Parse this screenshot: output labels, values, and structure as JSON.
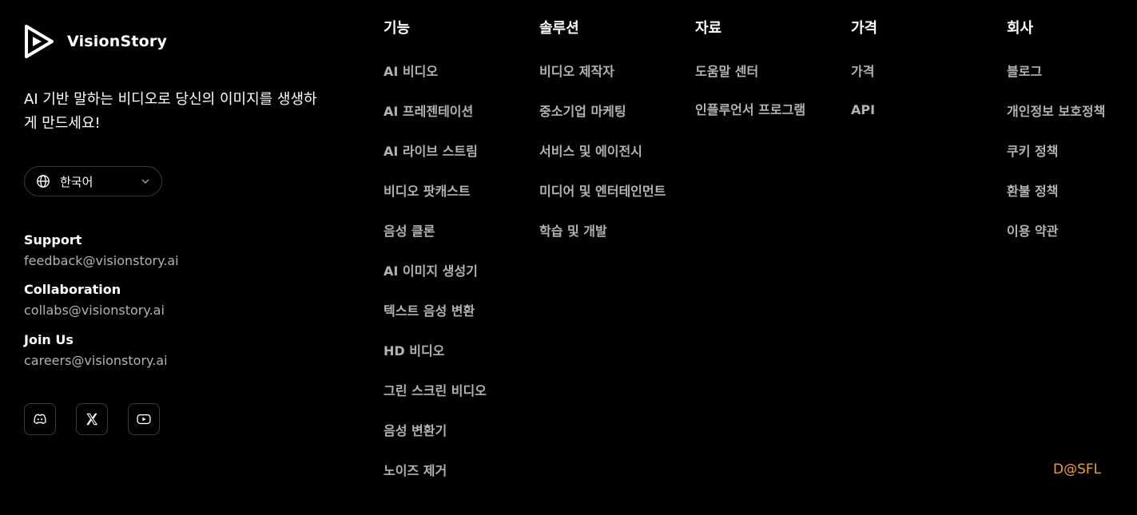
{
  "brand": {
    "name": "VisionStory"
  },
  "tagline": "AI 기반 말하는 비디오로 당신의 이미지를 생생하게 만드세요!",
  "language": {
    "selected": "한국어",
    "icon": "globe-icon"
  },
  "contacts": [
    {
      "title": "Support",
      "email": "feedback@visionstory.ai"
    },
    {
      "title": "Collaboration",
      "email": "collabs@visionstory.ai"
    },
    {
      "title": "Join Us",
      "email": "careers@visionstory.ai"
    }
  ],
  "socials": [
    {
      "name": "discord",
      "icon": "discord-icon"
    },
    {
      "name": "x",
      "icon": "x-icon"
    },
    {
      "name": "youtube",
      "icon": "youtube-icon"
    }
  ],
  "columns": [
    {
      "title": "기능",
      "links": [
        "AI 비디오",
        "AI 프레젠테이션",
        "AI 라이브 스트림",
        "비디오 팟캐스트",
        "음성 클론",
        "AI 이미지 생성기",
        "텍스트 음성 변환",
        "HD 비디오",
        "그린 스크린 비디오",
        "음성 변환기",
        "노이즈 제거"
      ]
    },
    {
      "title": "솔루션",
      "links": [
        "비디오 제작자",
        "중소기업 마케팅",
        "서비스 및 에이전시",
        "미디어 및 엔터테인먼트",
        "학습 및 개발"
      ]
    },
    {
      "title": "자료",
      "links": [
        "도움말 센터",
        "인플루언서 프로그램"
      ]
    },
    {
      "title": "가격",
      "links": [
        "가격",
        "API"
      ]
    },
    {
      "title": "회사",
      "links": [
        "블로그",
        "개인정보 보호정책",
        "쿠키 정책",
        "환불 정책",
        "이용 약관"
      ]
    }
  ],
  "watermark": "D@SFL",
  "colors": {
    "background": "#000000",
    "link": "#b3b3b3",
    "heading": "#ffffff",
    "watermark": "#f0a020"
  }
}
